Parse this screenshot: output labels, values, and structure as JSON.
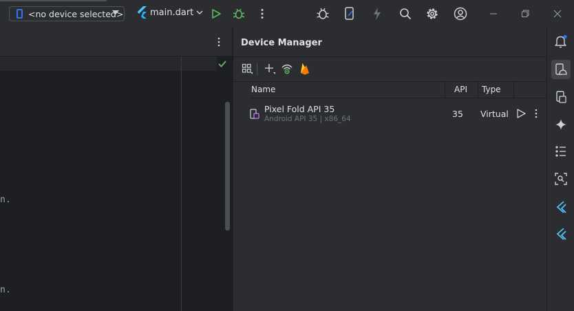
{
  "toolbar": {
    "device_selector": "<no device selected>",
    "file_selector": "main.dart"
  },
  "editor": {
    "code_fragments": [
      "n.",
      "n."
    ]
  },
  "device_manager": {
    "title": "Device Manager",
    "columns": {
      "name": "Name",
      "api": "API",
      "type": "Type"
    },
    "devices": [
      {
        "name": "Pixel Fold API 35",
        "details": "Android API 35 | x86_64",
        "api": "35",
        "type": "Virtual"
      }
    ]
  },
  "colors": {
    "accent": "#3574f0",
    "run_green": "#5fb865",
    "firebase": "#f5a623",
    "flutter": "#4fc3f7",
    "check": "#5fb865"
  },
  "icons": [
    "phone-icon",
    "flutter-icon",
    "run-icon",
    "debug-icon",
    "more-vert-icon",
    "bug-report-icon",
    "device-mirror-icon",
    "lightning-icon",
    "search-icon",
    "settings-icon",
    "account-icon",
    "minimize-icon",
    "restore-icon",
    "close-icon",
    "bell-icon",
    "device-manager-icon",
    "running-devices-icon",
    "ai-sparkle-icon",
    "structure-icon",
    "layout-inspector-icon",
    "flutter-inspector-icon",
    "flutter-outline-icon"
  ]
}
